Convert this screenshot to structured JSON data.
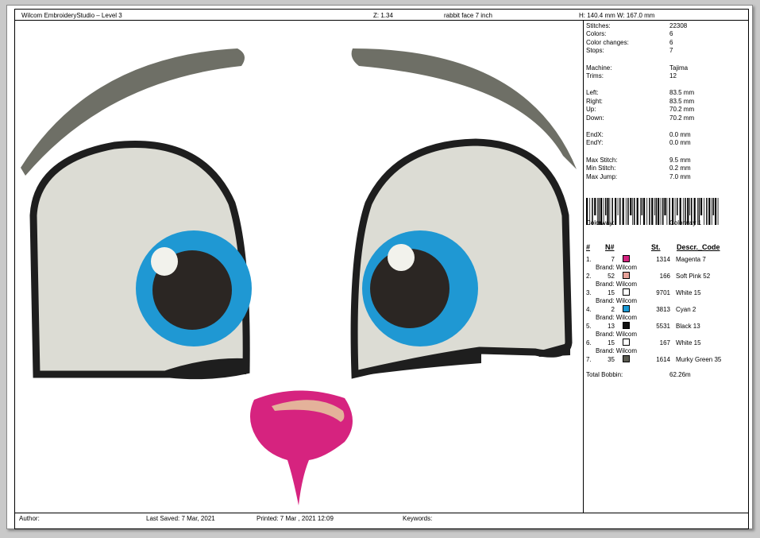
{
  "header": {
    "app": "Wilcom EmbroideryStudio – Level 3",
    "zoom": "Z: 1.34",
    "design_name": "rabbit face 7 inch",
    "size": "H: 140.4 mm   W: 167.0 mm"
  },
  "stats": [
    {
      "label": "Stitches:",
      "value": "22308"
    },
    {
      "label": "Colors:",
      "value": "6"
    },
    {
      "label": "Color changes:",
      "value": "6"
    },
    {
      "label": "Stops:",
      "value": "7"
    },
    {
      "label": "Machine:",
      "value": "Tajima"
    },
    {
      "label": "Trims:",
      "value": "12"
    },
    {
      "label": "Left:",
      "value": "83.5 mm"
    },
    {
      "label": "Right:",
      "value": "83.5 mm"
    },
    {
      "label": "Up:",
      "value": "70.2 mm"
    },
    {
      "label": "Down:",
      "value": "70.2 mm"
    },
    {
      "label": "EndX:",
      "value": "0.0 mm"
    },
    {
      "label": "EndY:",
      "value": "0.0 mm"
    },
    {
      "label": "Max Stitch:",
      "value": "9.5 mm"
    },
    {
      "label": "Min Stitch:",
      "value": "0.2 mm"
    },
    {
      "label": "Max Jump:",
      "value": "7.0 mm"
    }
  ],
  "colorway": {
    "label": "Colorway:",
    "value": "Colorway 1"
  },
  "table_headers": {
    "idx": "#",
    "needle": "N#",
    "stitches": "St.",
    "desc": "Descr._Code"
  },
  "colors": [
    {
      "idx": "1.",
      "needle": "7",
      "swatch": "#d4237f",
      "stitches": "1314",
      "name": "Magenta 7",
      "brand": "Brand: Wilcom"
    },
    {
      "idx": "2.",
      "needle": "52",
      "swatch": "#e8a39a",
      "stitches": "166",
      "name": "Soft Pink 52",
      "brand": "Brand: Wilcom"
    },
    {
      "idx": "3.",
      "needle": "15",
      "swatch": "#ffffff",
      "stitches": "9701",
      "name": "White 15",
      "brand": "Brand: Wilcom"
    },
    {
      "idx": "4.",
      "needle": "2",
      "swatch": "#1a9ad6",
      "stitches": "3813",
      "name": "Cyan 2",
      "brand": "Brand: Wilcom"
    },
    {
      "idx": "5.",
      "needle": "13",
      "swatch": "#111111",
      "stitches": "5531",
      "name": "Black 13",
      "brand": "Brand: Wilcom"
    },
    {
      "idx": "6.",
      "needle": "15",
      "swatch": "#ffffff",
      "stitches": "167",
      "name": "White 15",
      "brand": "Brand: Wilcom"
    },
    {
      "idx": "7.",
      "needle": "35",
      "swatch": "#5a5a50",
      "stitches": "1614",
      "name": "Murky Green 35",
      "brand": ""
    }
  ],
  "total_bobbin": {
    "label": "Total Bobbin:",
    "value": "62.26m"
  },
  "footer": {
    "author": "Author:",
    "last_saved": "Last Saved:  7 Mar, 2021",
    "printed": "Printed:  7 Mar , 2021 12:09",
    "keywords": "Keywords:"
  },
  "design_colors": {
    "brow": "#6e6f66",
    "outline": "#1e1e1e",
    "eye_white": "#dcdcd4",
    "iris": "#1f98d3",
    "pupil": "#2b2623",
    "highlight": "#f2f2ec",
    "nose": "#d6237f",
    "nose_stroke": "#e4b29a"
  }
}
